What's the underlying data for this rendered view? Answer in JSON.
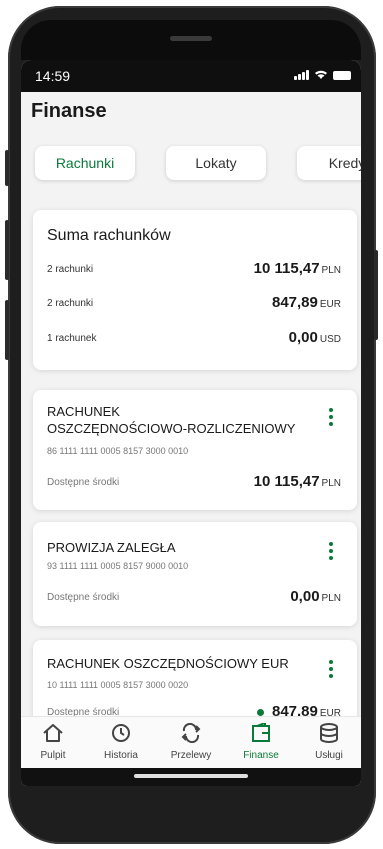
{
  "status_bar": {
    "time": "14:59"
  },
  "header": {
    "title": "Finanse"
  },
  "tabs": [
    {
      "label": "Rachunki",
      "active": true
    },
    {
      "label": "Lokaty",
      "active": false
    },
    {
      "label": "Kredy",
      "active": false
    }
  ],
  "summary": {
    "title": "Suma rachunków",
    "rows": [
      {
        "label": "2 rachunki",
        "amount": "10 115,47",
        "currency": "PLN"
      },
      {
        "label": "2 rachunki",
        "amount": "847,89",
        "currency": "EUR"
      },
      {
        "label": "1 rachunek",
        "amount": "0,00",
        "currency": "USD"
      }
    ]
  },
  "accounts": [
    {
      "name_line1": "RACHUNEK",
      "name_line2": "OSZCZĘDNOŚCIOWO-ROZLICZENIOWY",
      "number": "86 1111 1111 0005 8157 3000 0010",
      "available_label": "Dostępne środki",
      "balance": "10 115,47",
      "currency": "PLN"
    },
    {
      "name_line1": "PROWIZJA ZALEGŁA",
      "number": "93 1111 1111 0005 8157 9000 0010",
      "available_label": "Dostępne środki",
      "balance": "0,00",
      "currency": "PLN"
    },
    {
      "name_line1": "RACHUNEK OSZCZĘDNOŚCIOWY EUR",
      "number": "10 1111 1111 0005 8157 3000 0020",
      "available_label": "Dostepne środki",
      "balance": "847,89",
      "currency": "EUR"
    }
  ],
  "bottom_nav": [
    {
      "label": "Pulpit",
      "icon": "home-icon"
    },
    {
      "label": "Historia",
      "icon": "history-icon"
    },
    {
      "label": "Przelewy",
      "icon": "transfer-icon"
    },
    {
      "label": "Finanse",
      "icon": "finance-icon",
      "active": true
    },
    {
      "label": "Usługi",
      "icon": "services-icon"
    }
  ],
  "colors": {
    "accent": "#0a7a3a",
    "background": "#f3f3f3",
    "frame": "#1e1e1e"
  }
}
